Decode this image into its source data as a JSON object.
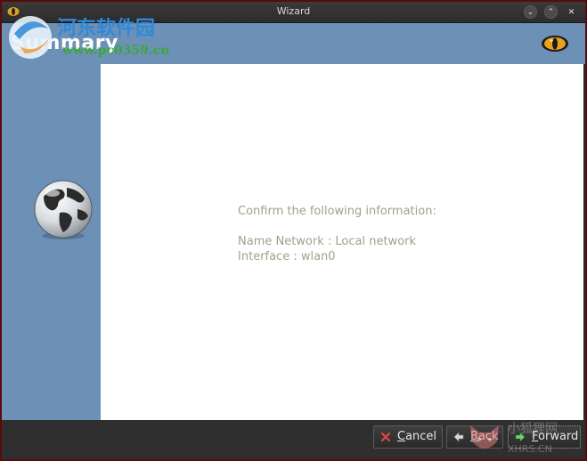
{
  "window": {
    "title": "Wizard",
    "buttons": {
      "minimize": "⌄",
      "maximize": "⌃",
      "close": "✕"
    }
  },
  "header": {
    "heading": "Summary"
  },
  "watermark": {
    "site_name": "河东软件园",
    "url": "www.pc0359.cn",
    "corner_text": "小狐狸网",
    "corner_sub": "XHRS.CN"
  },
  "content": {
    "intro": "Confirm the following information:",
    "fields": [
      "Name Network : Local network",
      "Interface : wlan0"
    ]
  },
  "footer": {
    "cancel_label_underlined": "C",
    "cancel_label_rest": "ancel",
    "back_label_underlined": "B",
    "back_label_rest": "ack",
    "forward_label_underlined": "F",
    "forward_label_rest": "orward"
  },
  "colors": {
    "sidebar": "#6d90b7",
    "content_bg": "#ffffff",
    "info_text": "#a3a08b",
    "footer": "#2f2f2f"
  },
  "icons": [
    "eye-icon",
    "globe-icon",
    "cancel-icon",
    "back-arrow-icon",
    "forward-arrow-icon"
  ]
}
